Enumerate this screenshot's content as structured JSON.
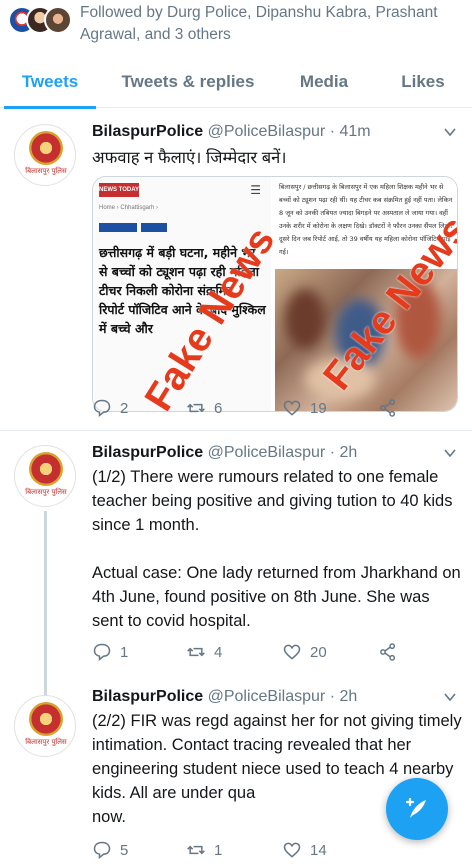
{
  "followed": {
    "text": "Followed by Durg Police, Dipanshu Kabra, Prashant Agrawal, and 3 others"
  },
  "tabs": [
    {
      "label": "Tweets",
      "active": true
    },
    {
      "label": "Tweets & replies",
      "active": false
    },
    {
      "label": "Media",
      "active": false
    },
    {
      "label": "Likes",
      "active": false
    }
  ],
  "tweets": [
    {
      "name": "BilaspurPolice",
      "handle": "@PoliceBilaspur",
      "time": "· 41m",
      "text": "अफवाह न फैलाएं। जिम्मेदार बनें।",
      "replies": "2",
      "retweets": "6",
      "likes": "19",
      "media": {
        "left_brand": "NEWS TODAY",
        "left_crumb": "Home › Chhattisgarh ›",
        "left_headline": "छत्तीसगढ़ में बड़ी घटना, महीने भर से बच्चों को ट्यूशन पढ़ा रही महिला टीचर निकली कोरोना संक्रमित, रिपोर्ट पॉजिटिव आने के बाद मुश्किल में बच्चे और",
        "right_text": "बिलासपुर / छत्तीसगढ़ के बिलासपुर में एक महिला शिक्षक महीने भर से बच्चों को ट्यूशन पढ़ा रही थीं। यह टीचर कब संक्रमित हुई नहीं पता। लेकिन 8 जून को उनकी तबियत ज्यादा बिगड़ने पर अस्पताल ले जाया गया। वहीं उनके शरीर में कोरोना के लक्षण दिखे। डॉक्टरों ने फौरन उनका सैंपल लिया। दूसरे दिन जब रिपोर्ट आई, तो 39 वर्षीय यह महिला कोरोना पॉजिटिव पाई गई।",
        "watermark_left": "Fake News",
        "watermark_right": "Fake News"
      }
    },
    {
      "name": "BilaspurPolice",
      "handle": "@PoliceBilaspur",
      "time": "· 2h",
      "text": "(1/2) There were rumours related to one female teacher being positive and giving tution to 40 kids since 1 month.\n\nActual case: One lady returned from Jharkhand on 4th June, found positive on 8th June. She was sent to covid hospital.",
      "replies": "1",
      "retweets": "4",
      "likes": "20"
    },
    {
      "name": "BilaspurPolice",
      "handle": "@PoliceBilaspur",
      "time": "· 2h",
      "text": "(2/2) FIR was regd against her for not giving timely intimation. Contact tracing revealed that her engineering student niece used to teach 4 nearby kids. All are under qua\nnow.",
      "replies": "5",
      "retweets": "1",
      "likes": "14"
    }
  ],
  "avatar_label": "बिलासपुर पुलिस",
  "colors": {
    "accent": "#1da1f2",
    "muted": "#657786",
    "watermark": "#e63a1c"
  }
}
